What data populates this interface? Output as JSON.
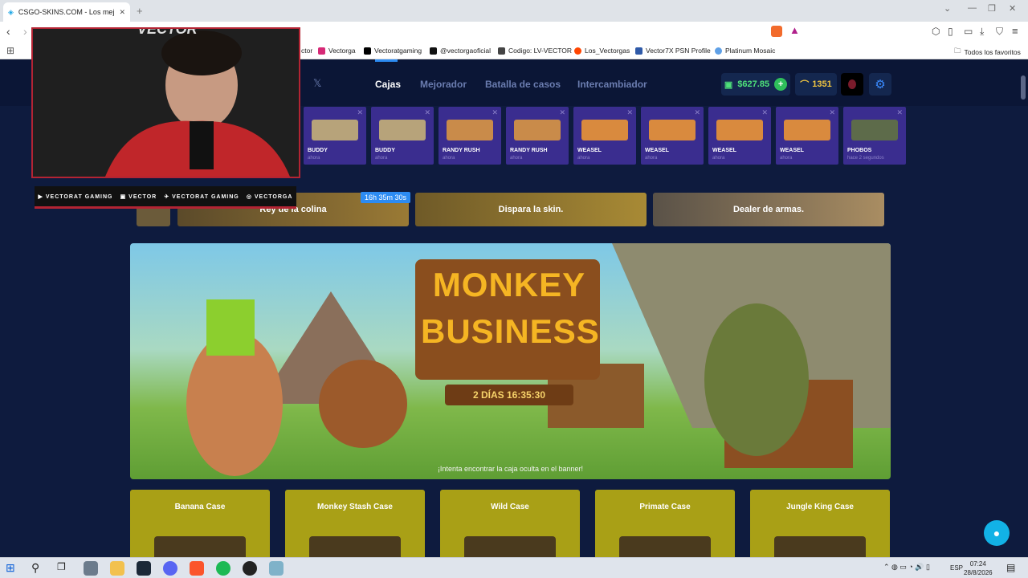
{
  "browser": {
    "tab_title": "CSGO-SKINS.COM - Los mejores",
    "bookmarks": [
      "ctor",
      "Vectorga",
      "Vectoratgaming",
      "@vectorgaoficial",
      "Codigo: LV-VECTOR",
      "Los_Vectorgas",
      "Vector7X PSN Profile",
      "Platinum Mosaic"
    ],
    "all_favorites": "Todos los favoritos"
  },
  "site": {
    "nav": {
      "cases": "Cajas",
      "upgrader": "Mejorador",
      "battles": "Batalla de casos",
      "exchanger": "Intercambiador"
    },
    "balance": "$627.85",
    "coins": "1351",
    "live_drops": [
      {
        "name": "BUDDY",
        "time": "ahora",
        "color": "#b7a37a"
      },
      {
        "name": "BUDDY",
        "time": "ahora",
        "color": "#b7a37a"
      },
      {
        "name": "RANDY RUSH",
        "time": "ahora",
        "color": "#c98b4a"
      },
      {
        "name": "RANDY RUSH",
        "time": "ahora",
        "color": "#c98b4a"
      },
      {
        "name": "WEASEL",
        "time": "ahora",
        "color": "#d98a3e"
      },
      {
        "name": "WEASEL",
        "time": "ahora",
        "color": "#d98a3e"
      },
      {
        "name": "WEASEL",
        "time": "ahora",
        "color": "#d98a3e"
      },
      {
        "name": "WEASEL",
        "time": "ahora",
        "color": "#d98a3e"
      },
      {
        "name": "PHOBOS",
        "time": "hace 2 segundos",
        "color": "#5d6b4a"
      }
    ],
    "promos": {
      "king": "Rey de la colina",
      "timer": "16h 35m 30s",
      "shoot": "Dispara la skin.",
      "dealer": "Dealer de armas."
    },
    "banner": {
      "title_line1": "MONKEY",
      "title_line2": "BUSINESS",
      "countdown": "2 DÍAS 16:35:30",
      "hint": "¡Intenta encontrar la caja oculta en el banner!"
    },
    "cases": [
      "Banana Case",
      "Monkey Stash Case",
      "Wild Case",
      "Primate Case",
      "Jungle King Case"
    ]
  },
  "overlay": {
    "cam_logo": "VECTOR",
    "socials": [
      "VECTORAT GAMING",
      "VECTOR",
      "VECTORAT GAMING",
      "VECTORGA"
    ]
  },
  "taskbar": {
    "lang": "ESP",
    "time": "07:24",
    "date": "28/8/2026"
  }
}
